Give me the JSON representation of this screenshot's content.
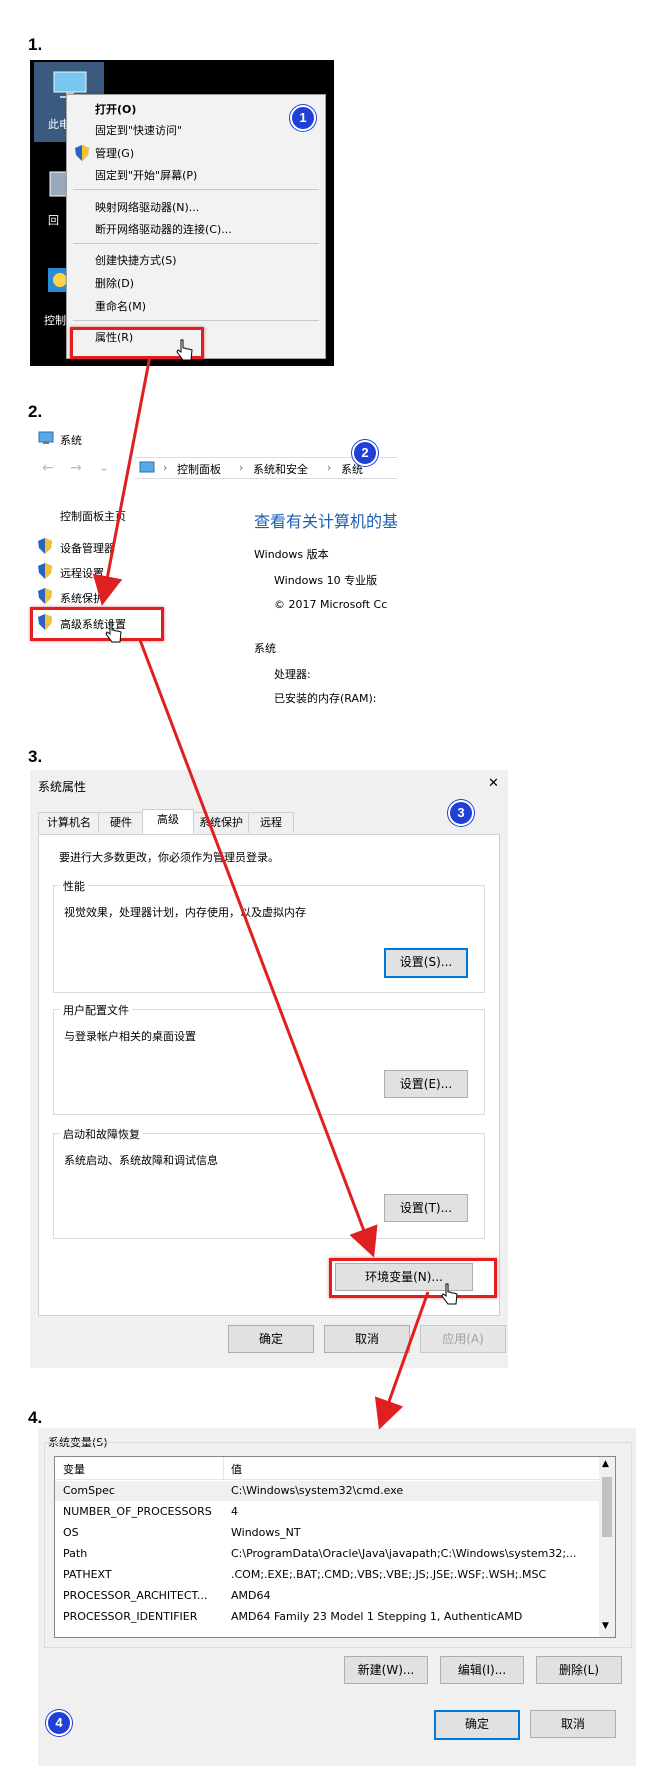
{
  "steps": [
    "1.",
    "2.",
    "3.",
    "4."
  ],
  "step_badges": [
    "1",
    "2",
    "3",
    "4"
  ],
  "colors": {
    "accent_red": "#e02020",
    "badge_blue": "#1f3fd6",
    "focus_blue": "#0078d7"
  },
  "step1": {
    "desktop_icons": [
      "此电",
      "回",
      "控制"
    ],
    "menu": {
      "items": [
        {
          "label": "打开(O)",
          "bold": true
        },
        {
          "label": "固定到\"快速访问\""
        },
        {
          "label": "管理(G)",
          "icon": "shield-icon"
        },
        {
          "label": "固定到\"开始\"屏幕(P)"
        },
        {
          "label": "映射网络驱动器(N)..."
        },
        {
          "label": "断开网络驱动器的连接(C)..."
        },
        {
          "label": "创建快捷方式(S)"
        },
        {
          "label": "删除(D)"
        },
        {
          "label": "重命名(M)"
        },
        {
          "label": "属性(R)"
        }
      ]
    }
  },
  "step2": {
    "window_title": "系统",
    "breadcrumb": [
      "控制面板",
      "系统和安全",
      "系统"
    ],
    "sidebar": {
      "home": "控制面板主页",
      "links": [
        "设备管理器",
        "远程设置",
        "系统保护",
        "高级系统设置"
      ]
    },
    "main": {
      "heading": "查看有关计算机的基",
      "edition_label": "Windows 版本",
      "edition": "Windows 10 专业版",
      "copyright": "© 2017 Microsoft Cc",
      "system_label": "系统",
      "processor_label": "处理器:",
      "ram_label": "已安装的内存(RAM):"
    }
  },
  "step3": {
    "title": "系统属性",
    "close_icon": "✕",
    "tabs": [
      "计算机名",
      "硬件",
      "高级",
      "系统保护",
      "远程"
    ],
    "active_tab": "高级",
    "admin_note": "要进行大多数更改，你必须作为管理员登录。",
    "groups": [
      {
        "label": "性能",
        "desc": "视觉效果，处理器计划，内存使用，以及虚拟内存",
        "button": "设置(S)..."
      },
      {
        "label": "用户配置文件",
        "desc": "与登录帐户相关的桌面设置",
        "button": "设置(E)..."
      },
      {
        "label": "启动和故障恢复",
        "desc": "系统启动、系统故障和调试信息",
        "button": "设置(T)..."
      }
    ],
    "env_button": "环境变量(N)...",
    "ok": "确定",
    "cancel": "取消",
    "apply": "应用(A)"
  },
  "step4": {
    "group_label": "系统变量(S)",
    "columns": [
      "变量",
      "值"
    ],
    "rows": [
      {
        "var": "ComSpec",
        "val": "C:\\Windows\\system32\\cmd.exe"
      },
      {
        "var": "NUMBER_OF_PROCESSORS",
        "val": "4"
      },
      {
        "var": "OS",
        "val": "Windows_NT"
      },
      {
        "var": "Path",
        "val": "C:\\ProgramData\\Oracle\\Java\\javapath;C:\\Windows\\system32;..."
      },
      {
        "var": "PATHEXT",
        "val": ".COM;.EXE;.BAT;.CMD;.VBS;.VBE;.JS;.JSE;.WSF;.WSH;.MSC"
      },
      {
        "var": "PROCESSOR_ARCHITECT...",
        "val": "AMD64"
      },
      {
        "var": "PROCESSOR_IDENTIFIER",
        "val": "AMD64 Family 23 Model 1 Stepping 1, AuthenticAMD"
      }
    ],
    "new": "新建(W)...",
    "edit": "编辑(I)...",
    "delete": "删除(L)",
    "ok": "确定",
    "cancel": "取消"
  }
}
